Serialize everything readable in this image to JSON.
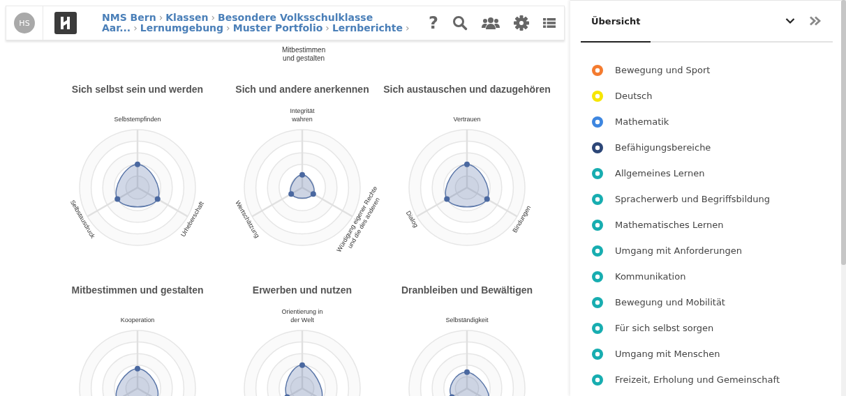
{
  "header": {
    "avatar": "HS",
    "breadcrumb": [
      [
        {
          "label": "NMS Bern",
          "sep": "›"
        },
        {
          "label": "Klassen",
          "sep": "›"
        },
        {
          "label": "Besondere Volksschulklasse"
        }
      ],
      [
        {
          "label": "Aar...",
          "sep": "›"
        },
        {
          "label": "Lernumgebung",
          "sep": "›"
        },
        {
          "label": "Muster Portfolio",
          "sep": "›"
        },
        {
          "label": "Lernberichte",
          "sep": "›"
        }
      ]
    ],
    "toolbar": [
      "?"
    ]
  },
  "fragment_label": [
    "Mitbestimmen",
    "und gestalten"
  ],
  "charts": [
    {
      "title": "Sich selbst sein und werden",
      "axis_top": [
        "Selbstempfinden"
      ],
      "axis_left": [
        "Selbstausdruck"
      ],
      "axis_right": [
        "Urheberschaft"
      ]
    },
    {
      "title": "Sich und andere anerkennen",
      "axis_top": [
        "Integrität",
        "wahren"
      ],
      "axis_left": [
        "Wertschätzung"
      ],
      "axis_right": [
        "Würdigung eigener Rechte",
        "und die des anderen"
      ]
    },
    {
      "title": "Sich austauschen und dazugehören",
      "axis_top": [
        "Vertrauen"
      ],
      "axis_left": [
        "Dialog"
      ],
      "axis_right": [
        "Bindungen"
      ]
    },
    {
      "title": "Mitbestimmen und gestalten",
      "axis_top": [
        "Kooperation"
      ]
    },
    {
      "title": "Erwerben und nutzen",
      "axis_top": [
        "Orientierung in",
        "der Welt"
      ]
    },
    {
      "title": "Dranbleiben und Bewältigen",
      "axis_top": [
        "Selbständigkeit"
      ]
    }
  ],
  "panel": {
    "tabs": [
      {
        "label": "Übersicht",
        "selected": true
      }
    ],
    "items": [
      {
        "label": "Bewegung und Sport",
        "color": "#f47b2f"
      },
      {
        "label": "Deutsch",
        "color": "#f6e600"
      },
      {
        "label": "Mathematik",
        "color": "#3d86e0"
      },
      {
        "label": "Befähigungsbereiche",
        "color": "#2c4677"
      },
      {
        "label": "Allgemeines Lernen",
        "color": "#17adb0"
      },
      {
        "label": "Spracherwerb und Begriffsbildung",
        "color": "#17adb0"
      },
      {
        "label": "Mathematisches Lernen",
        "color": "#17adb0"
      },
      {
        "label": "Umgang mit Anforderungen",
        "color": "#17adb0"
      },
      {
        "label": "Kommunikation",
        "color": "#17adb0"
      },
      {
        "label": "Bewegung und Mobilität",
        "color": "#17adb0"
      },
      {
        "label": "Für sich selbst sorgen",
        "color": "#17adb0"
      },
      {
        "label": "Umgang mit Menschen",
        "color": "#17adb0"
      },
      {
        "label": "Freizeit, Erholung und Gemeinschaft",
        "color": "#17adb0"
      }
    ]
  }
}
